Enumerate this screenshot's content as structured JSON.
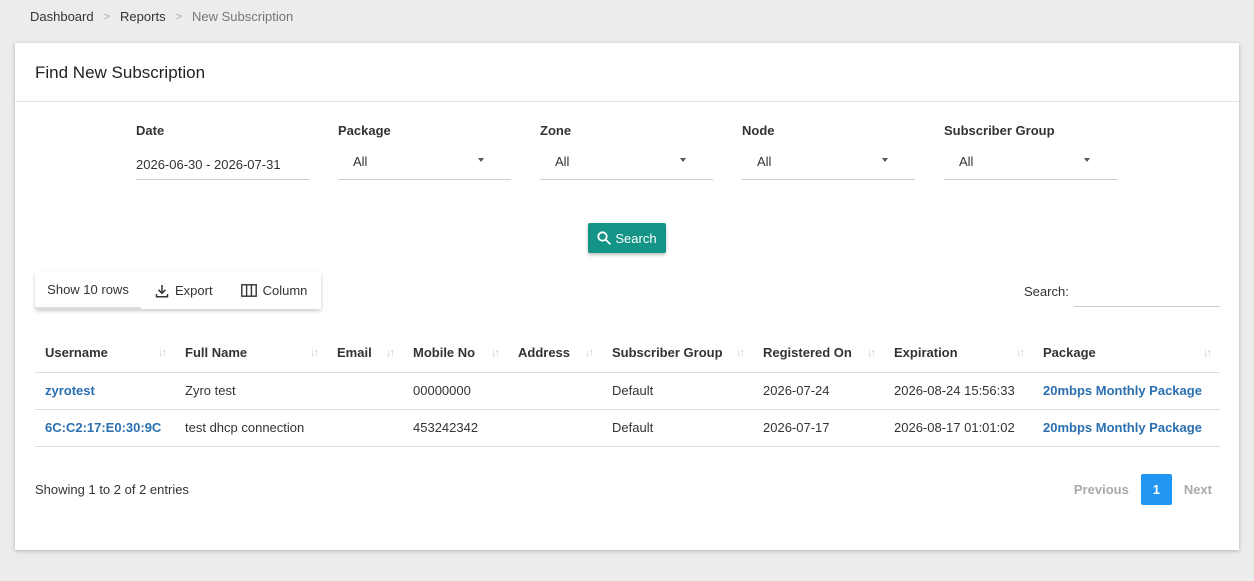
{
  "breadcrumb": [
    "Dashboard",
    "Reports",
    "New Subscription"
  ],
  "breadcrumb_sep": ">",
  "card_title": "Find New Subscription",
  "filters": {
    "date": {
      "label": "Date",
      "value": "2026-06-30 - 2026-07-31"
    },
    "package": {
      "label": "Package",
      "value": "All"
    },
    "zone": {
      "label": "Zone",
      "value": "All"
    },
    "node": {
      "label": "Node",
      "value": "All"
    },
    "subscriber_group": {
      "label": "Subscriber Group",
      "value": "All"
    }
  },
  "search_button": "Search",
  "toolbar": {
    "show_rows": "Show 10 rows",
    "export": "Export",
    "column": "Column"
  },
  "table_search_label": "Search:",
  "table": {
    "headers": [
      "Username",
      "Full Name",
      "Email",
      "Mobile No",
      "Address",
      "Subscriber Group",
      "Registered On",
      "Expiration",
      "Package"
    ],
    "rows": [
      [
        "zyrotest",
        "Zyro test",
        "",
        "00000000",
        "",
        "Default",
        "2026-07-24",
        "2026-08-24 15:56:33",
        "20mbps Monthly Package"
      ],
      [
        "6C:C2:17:E0:30:9C",
        "test dhcp connection",
        "",
        "453242342",
        "",
        "Default",
        "2026-07-17",
        "2026-08-17 01:01:02",
        "20mbps Monthly Package"
      ]
    ]
  },
  "info": "Showing 1 to 2 of 2 entries",
  "pagination": {
    "previous": "Previous",
    "current": "1",
    "next": "Next"
  },
  "colors": {
    "accent": "#149486",
    "link": "#2a6fb0",
    "page_active": "#2196f3"
  },
  "icons": {
    "search": "search-icon",
    "export": "download-icon",
    "column": "columns-icon",
    "sort": "sort-icon"
  }
}
